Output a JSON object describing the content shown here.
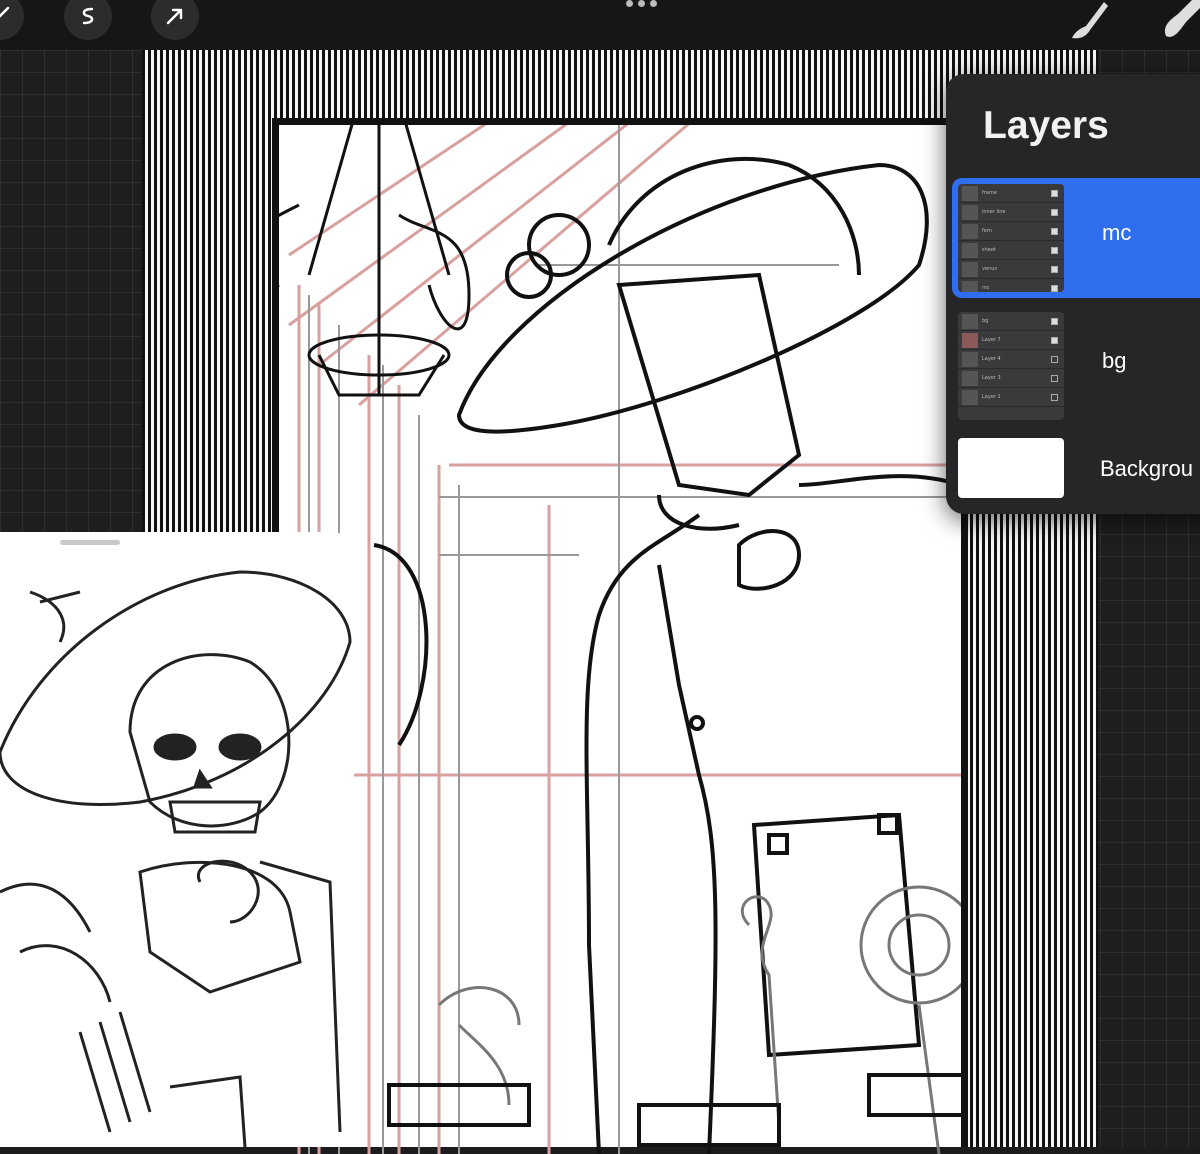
{
  "layers_panel": {
    "title": "Layers",
    "groups": [
      {
        "name": "mc",
        "selected": true,
        "sublayers": [
          {
            "name": "frame",
            "checked": true
          },
          {
            "name": "inner line",
            "checked": true
          },
          {
            "name": "fern",
            "checked": true
          },
          {
            "name": "sheet",
            "checked": true
          },
          {
            "name": "venus",
            "checked": true
          },
          {
            "name": "mc",
            "checked": true
          }
        ]
      },
      {
        "name": "bg",
        "selected": false,
        "sublayers": [
          {
            "name": "bg",
            "checked": true
          },
          {
            "name": "Layer 7",
            "checked": true
          },
          {
            "name": "Layer 4",
            "checked": false
          },
          {
            "name": "Layer 3",
            "checked": false
          },
          {
            "name": "Layer 1",
            "checked": false
          }
        ]
      }
    ],
    "background_layer": "Backgrou"
  },
  "toolbar": {
    "left_icons": [
      "adjustments-icon",
      "selection-icon",
      "transform-icon"
    ],
    "right_icons": [
      "brush-icon",
      "smudge-icon"
    ]
  },
  "colors": {
    "accent": "#2f6fef",
    "panel": "#262628",
    "toolbar": "#161618"
  }
}
